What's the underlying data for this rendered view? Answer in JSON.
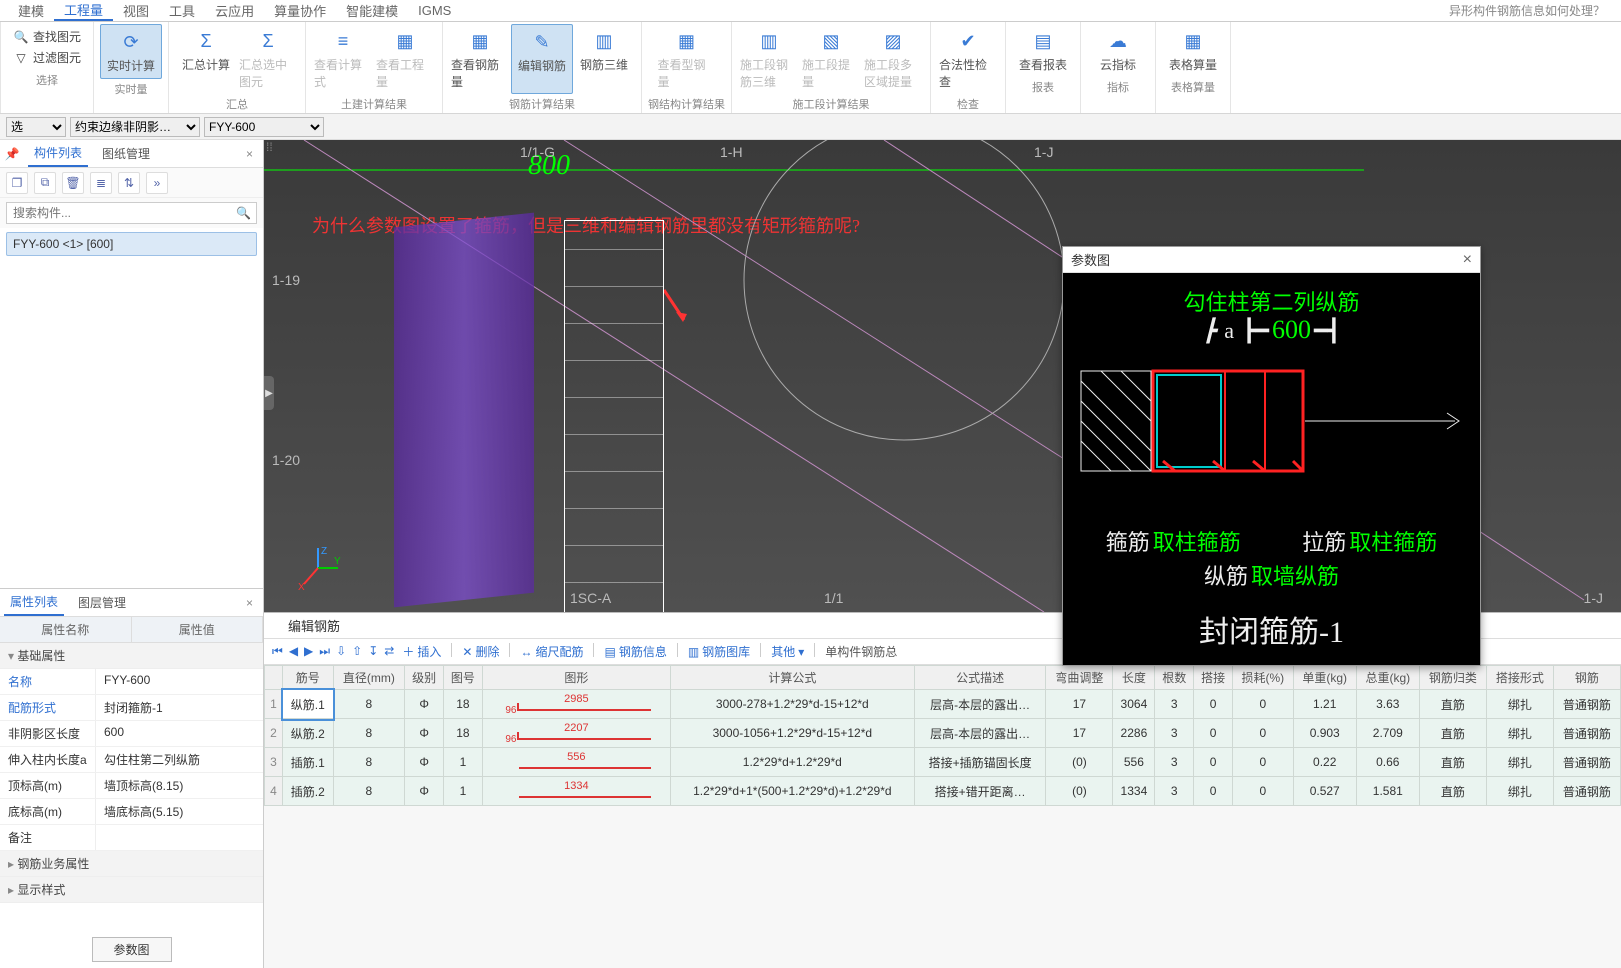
{
  "menu": [
    "建模",
    "工程量",
    "视图",
    "工具",
    "云应用",
    "算量协作",
    "智能建模",
    "IGMS"
  ],
  "menu_active_index": 1,
  "top_right_question": "异形构件钢筋信息如何处理？",
  "left_quick": {
    "find": "查找图元",
    "filter": "过滤图元",
    "select_label": "选择",
    "choose_label": "择"
  },
  "ribbon": {
    "groups": [
      {
        "label": "实时量",
        "items": [
          {
            "label": "实时计算",
            "icon": "⟳",
            "highlight": true
          }
        ]
      },
      {
        "label": "汇总",
        "items": [
          {
            "label": "汇总计算",
            "icon": "Σ"
          },
          {
            "label": "汇总选中图元",
            "icon": "Σ",
            "disabled": true
          }
        ]
      },
      {
        "label": "土建计算结果",
        "items": [
          {
            "label": "查看计算式",
            "icon": "≡",
            "disabled": true
          },
          {
            "label": "查看工程量",
            "icon": "▦",
            "disabled": true
          }
        ]
      },
      {
        "label": "钢筋计算结果",
        "items": [
          {
            "label": "查看钢筋量",
            "icon": "▦"
          },
          {
            "label": "编辑钢筋",
            "icon": "✎",
            "highlight": true
          },
          {
            "label": "钢筋三维",
            "icon": "▥"
          }
        ]
      },
      {
        "label": "钢结构计算结果",
        "items": [
          {
            "label": "查看型钢量",
            "icon": "▦",
            "disabled": true
          }
        ]
      },
      {
        "label": "施工段计算结果",
        "items": [
          {
            "label": "施工段钢筋三维",
            "icon": "▥",
            "disabled": true
          },
          {
            "label": "施工段提量",
            "icon": "▧",
            "disabled": true
          },
          {
            "label": "施工段多区域提量",
            "icon": "▨",
            "disabled": true
          }
        ]
      },
      {
        "label": "检查",
        "items": [
          {
            "label": "合法性检查",
            "icon": "✔"
          }
        ]
      },
      {
        "label": "报表",
        "items": [
          {
            "label": "查看报表",
            "icon": "▤"
          }
        ]
      },
      {
        "label": "指标",
        "items": [
          {
            "label": "云指标",
            "icon": "☁"
          }
        ]
      },
      {
        "label": "表格算量",
        "items": [
          {
            "label": "表格算量",
            "icon": "▦"
          }
        ]
      }
    ]
  },
  "sub_toolbar": {
    "dd1": "选",
    "dd2": "约束边缘非阴影…",
    "dd3": "FYY-600"
  },
  "left_panel": {
    "tabs": [
      "构件列表",
      "图纸管理"
    ],
    "active_tab": 0,
    "search_placeholder": "搜索构件...",
    "tree_item": "FYY-600 <1>  [600]"
  },
  "props_panel": {
    "tabs": [
      "属性列表",
      "图层管理"
    ],
    "active_tab": 0,
    "head": [
      "属性名称",
      "属性值"
    ],
    "group_basic": "基础属性",
    "rows": [
      {
        "k": "名称",
        "v": "FYY-600",
        "blue": true
      },
      {
        "k": "配筋形式",
        "v": "封闭箍筋-1",
        "blue": true
      },
      {
        "k": "非阴影区长度",
        "v": "600"
      },
      {
        "k": "伸入柱内长度a",
        "v": "勾住柱第二列纵筋"
      },
      {
        "k": "顶标高(m)",
        "v": "墙顶标高(8.15)"
      },
      {
        "k": "底标高(m)",
        "v": "墙底标高(5.15)"
      },
      {
        "k": "备注",
        "v": ""
      }
    ],
    "group_biz": "钢筋业务属性",
    "group_display": "显示样式",
    "footer_btn": "参数图"
  },
  "viewport": {
    "red_note": "为什么参数图设置了箍筋，但是三维和编辑钢筋里都没有矩形箍筋呢?",
    "dim_text": "800",
    "labels": {
      "top": [
        "1/1-G",
        "1-H",
        "1-J"
      ],
      "left": [
        "1-19",
        "1-20"
      ],
      "bottom": [
        "1SC-A",
        "1/1",
        "1-J"
      ]
    }
  },
  "param_window": {
    "title": "参数图",
    "line1_green": "勾住柱第二列纵筋",
    "dim_a": "a",
    "dim_b": "600",
    "gj_label": "箍筋",
    "gj_green": "取柱箍筋",
    "lj_label": "拉筋",
    "lj_green": "取柱箍筋",
    "zj_label": "纵筋",
    "zj_green": "取墙纵筋",
    "title_big": "封闭箍筋-1"
  },
  "edit": {
    "title": "编辑钢筋",
    "toolbar": [
      {
        "label": "插入",
        "icon": "＋"
      },
      {
        "label": "删除",
        "icon": "✕"
      },
      {
        "label": "缩尺配筋",
        "icon": "↔"
      },
      {
        "label": "钢筋信息",
        "icon": "▤"
      },
      {
        "label": "钢筋图库",
        "icon": "▥"
      },
      {
        "label": "其他",
        "dropdown": true
      },
      {
        "label": "单构件钢筋总",
        "plain": true
      }
    ],
    "nav_icons": [
      "⏮",
      "◀",
      "▶",
      "⏭",
      "⇩",
      "⇧",
      "↧",
      "⇄"
    ],
    "columns": [
      "",
      "筋号",
      "直径(mm)",
      "级别",
      "图号",
      "图形",
      "计算公式",
      "公式描述",
      "弯曲调整",
      "长度",
      "根数",
      "搭接",
      "损耗(%)",
      "单重(kg)",
      "总重(kg)",
      "钢筋归类",
      "搭接形式",
      "钢筋"
    ],
    "rows": [
      {
        "n": "1",
        "name": "纵筋.1",
        "dia": "8",
        "lvl": "Φ",
        "fig": "18",
        "shape_left": "96",
        "shape_num": "2985",
        "formula": "3000-278+1.2*29*d-15+12*d",
        "desc": "层高-本层的露出…",
        "bend": "17",
        "len": "3064",
        "cnt": "3",
        "lap": "0",
        "loss": "0",
        "uw": "1.21",
        "tw": "3.63",
        "cat": "直筋",
        "lapType": "绑扎",
        "type": "普通钢筋",
        "sel": true
      },
      {
        "n": "2",
        "name": "纵筋.2",
        "dia": "8",
        "lvl": "Φ",
        "fig": "18",
        "shape_left": "96",
        "shape_num": "2207",
        "formula": "3000-1056+1.2*29*d-15+12*d",
        "desc": "层高-本层的露出…",
        "bend": "17",
        "len": "2286",
        "cnt": "3",
        "lap": "0",
        "loss": "0",
        "uw": "0.903",
        "tw": "2.709",
        "cat": "直筋",
        "lapType": "绑扎",
        "type": "普通钢筋"
      },
      {
        "n": "3",
        "name": "插筋.1",
        "dia": "8",
        "lvl": "Φ",
        "fig": "1",
        "shape_left": "",
        "shape_num": "556",
        "formula": "1.2*29*d+1.2*29*d",
        "desc": "搭接+插筋锚固长度",
        "bend": "(0)",
        "len": "556",
        "cnt": "3",
        "lap": "0",
        "loss": "0",
        "uw": "0.22",
        "tw": "0.66",
        "cat": "直筋",
        "lapType": "绑扎",
        "type": "普通钢筋"
      },
      {
        "n": "4",
        "name": "插筋.2",
        "dia": "8",
        "lvl": "Φ",
        "fig": "1",
        "shape_left": "",
        "shape_num": "1334",
        "formula": "1.2*29*d+1*(500+1.2*29*d)+1.2*29*d",
        "desc": "搭接+错开距离…",
        "bend": "(0)",
        "len": "1334",
        "cnt": "3",
        "lap": "0",
        "loss": "0",
        "uw": "0.527",
        "tw": "1.581",
        "cat": "直筋",
        "lapType": "绑扎",
        "type": "普通钢筋"
      }
    ]
  }
}
